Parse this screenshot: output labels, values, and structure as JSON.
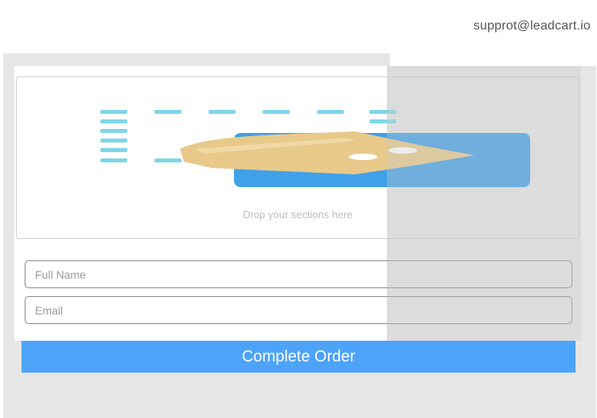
{
  "header": {
    "support_email": "supprot@leadcart.io"
  },
  "drop_zone": {
    "hint_text": "Drop your sections here",
    "icon": "drag-drop-card-illustration"
  },
  "form": {
    "full_name_placeholder": "Full Name",
    "email_placeholder": "Email",
    "submit_label": "Complete Order"
  },
  "colors": {
    "accent": "#4da3f7",
    "dashes": "#7fd6e6",
    "card_blue": "#40a0e8",
    "hand_tan": "#e8c98a"
  }
}
